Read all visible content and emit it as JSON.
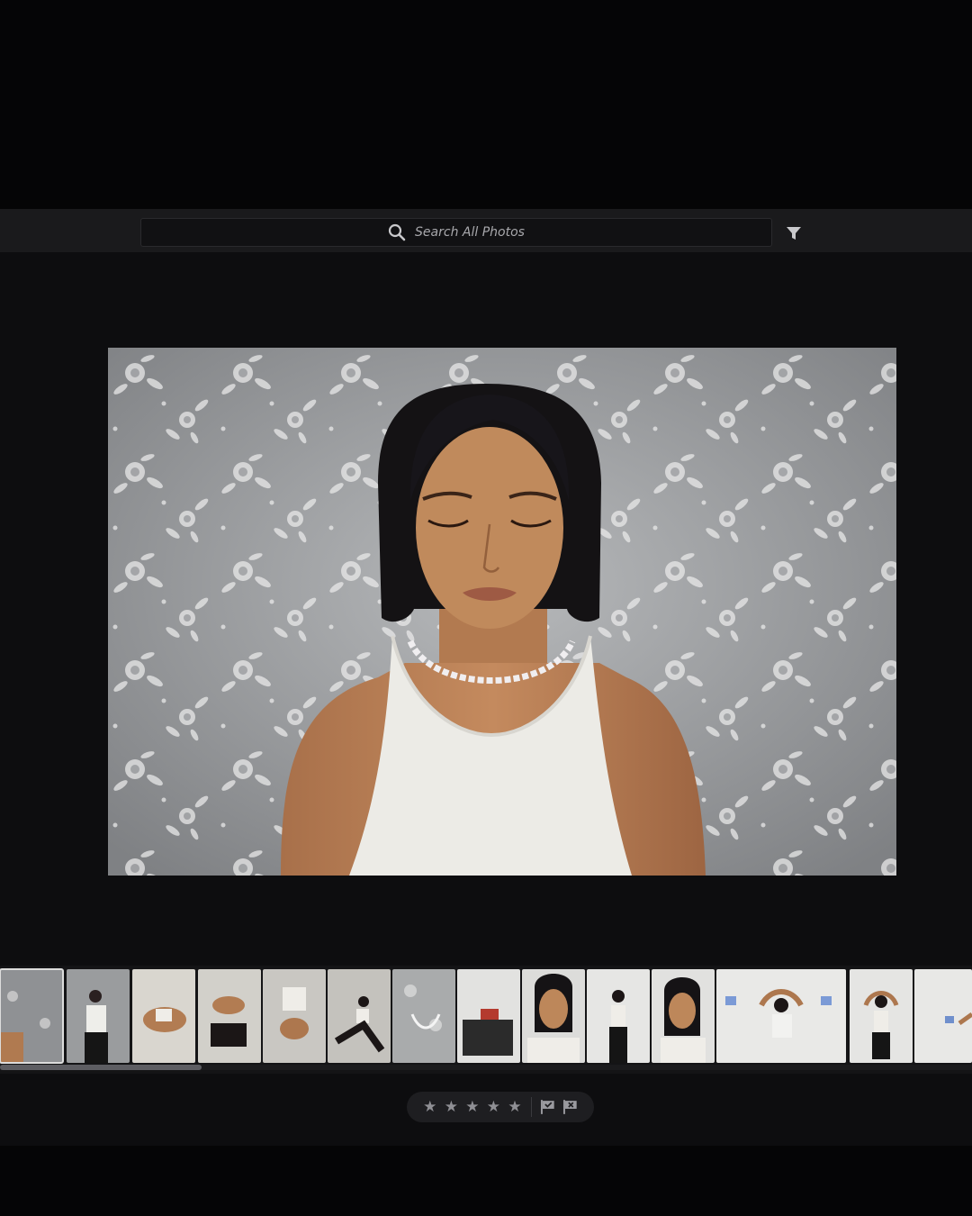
{
  "search": {
    "placeholder": "Search All Photos",
    "icon": "magnifier"
  },
  "toolbar": {
    "rating": {
      "max": 5,
      "value": 0,
      "icon": "star"
    },
    "flags": [
      "pick-flag",
      "reject-flag"
    ]
  },
  "filmstrip": {
    "selected_index": 0,
    "thumbnail_count": 15
  },
  "colors": {
    "background": "#0d0d0f",
    "panel": "#1a1a1c",
    "accent_text": "#a8a8ac"
  }
}
